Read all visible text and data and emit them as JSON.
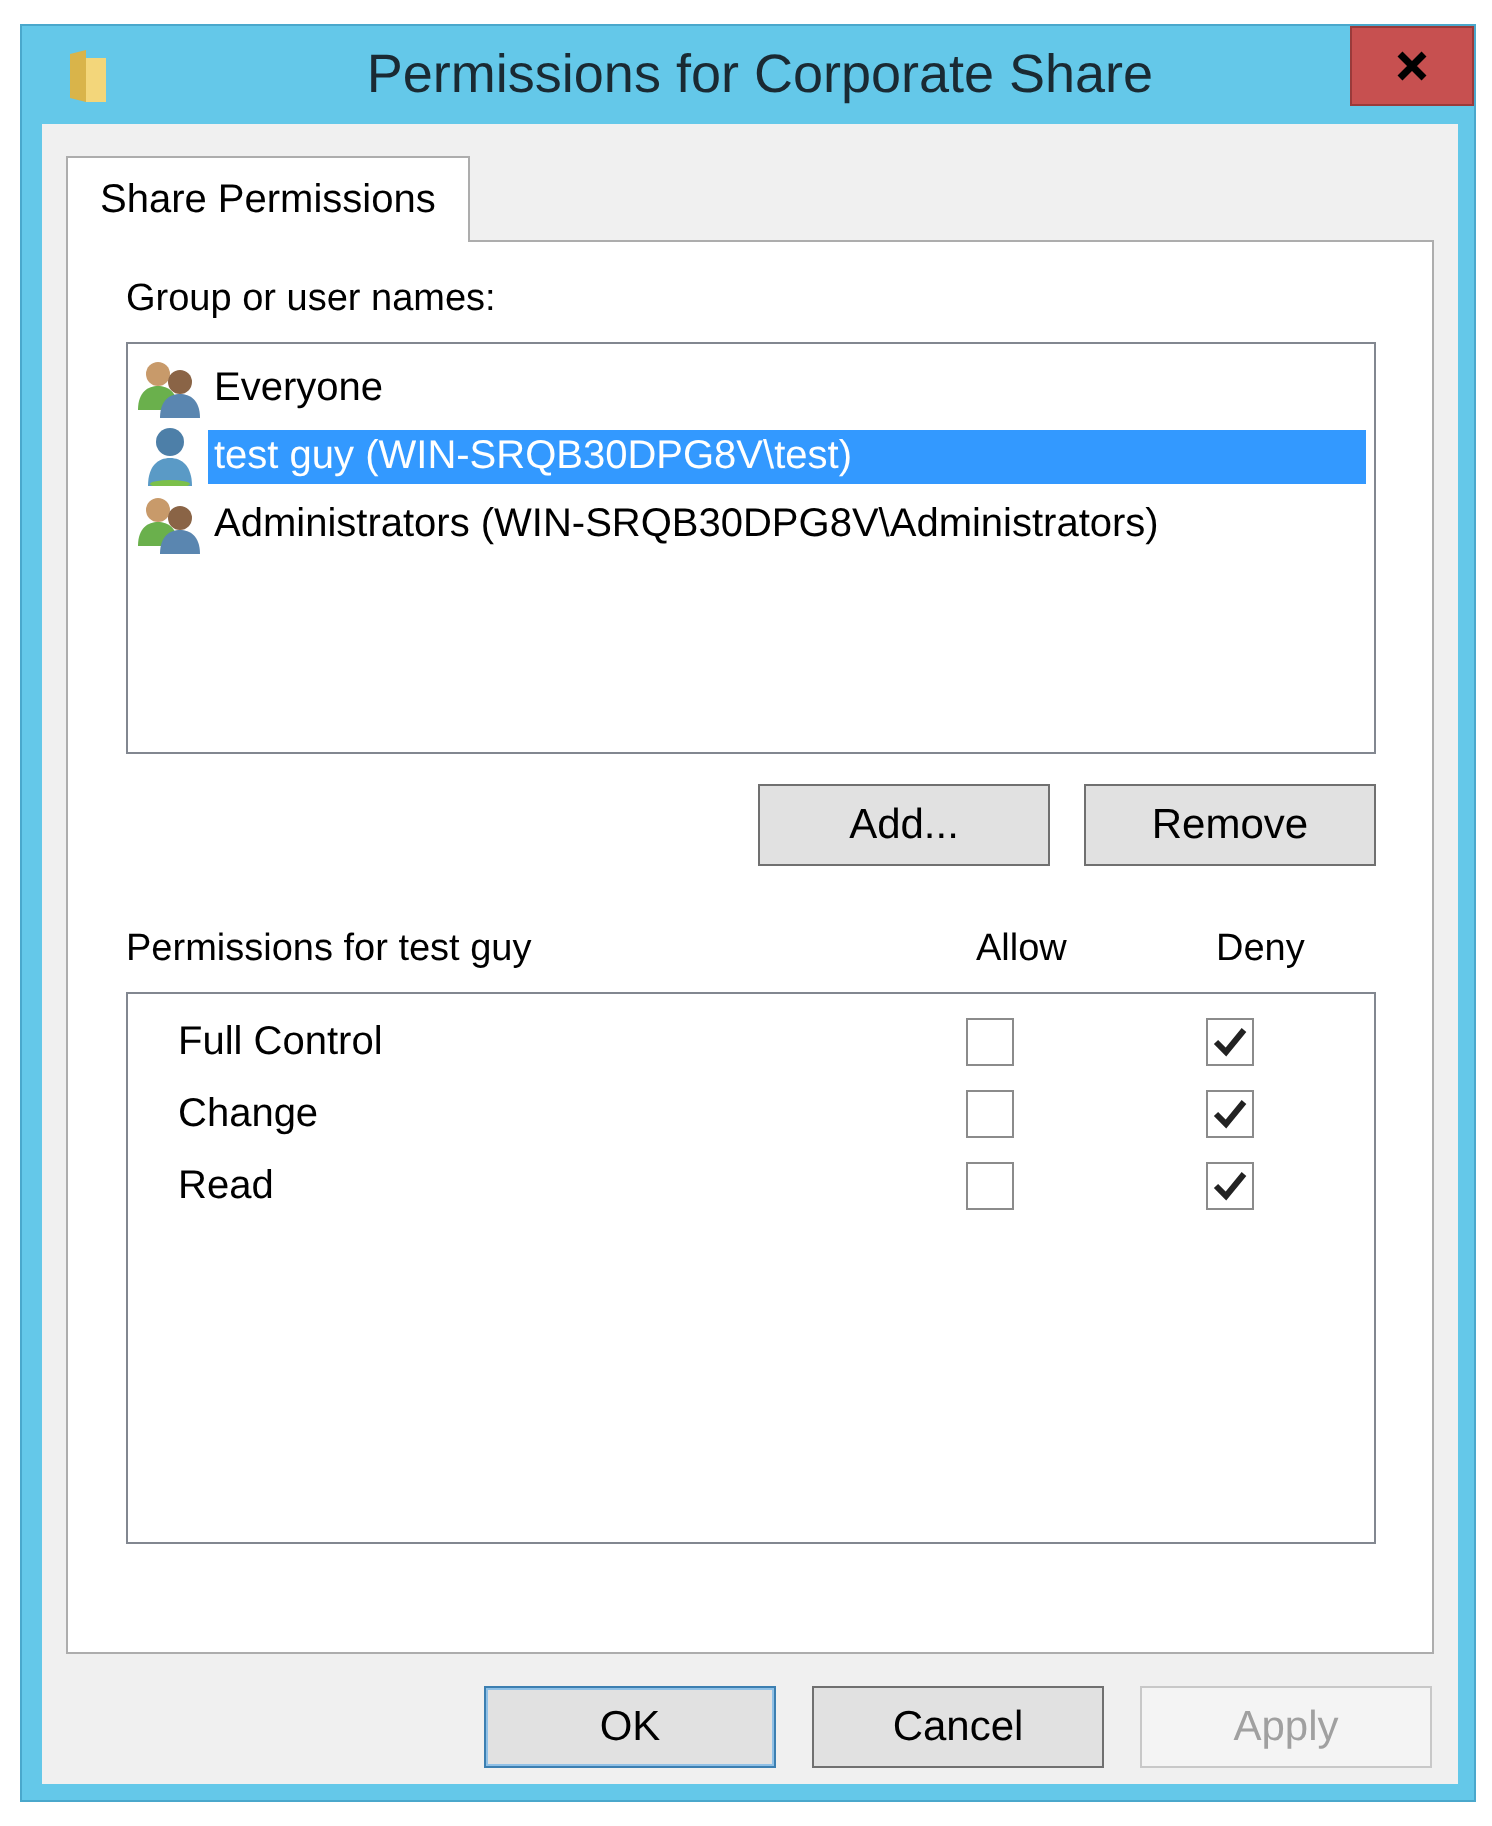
{
  "window": {
    "title": "Permissions for Corporate Share"
  },
  "tabs": [
    {
      "label": "Share Permissions",
      "selected": true
    }
  ],
  "users": {
    "label": "Group or user names:",
    "items": [
      {
        "name": "Everyone",
        "kind": "group",
        "selected": false
      },
      {
        "name": "test guy (WIN-SRQB30DPG8V\\test)",
        "kind": "user",
        "selected": true
      },
      {
        "name": "Administrators (WIN-SRQB30DPG8V\\Administrators)",
        "kind": "group",
        "selected": false
      }
    ],
    "buttons": [
      "Add...",
      "Remove"
    ]
  },
  "permissions": {
    "label": "Permissions for test guy",
    "columns": [
      "Allow",
      "Deny"
    ],
    "rows": [
      {
        "name": "Full Control",
        "allow": false,
        "deny": true
      },
      {
        "name": "Change",
        "allow": false,
        "deny": true
      },
      {
        "name": "Read",
        "allow": false,
        "deny": true
      }
    ]
  },
  "footer": [
    {
      "label": "OK",
      "kind": "default",
      "disabled": false
    },
    {
      "label": "Cancel",
      "kind": "normal",
      "disabled": false
    },
    {
      "label": "Apply",
      "kind": "normal",
      "disabled": true
    }
  ]
}
